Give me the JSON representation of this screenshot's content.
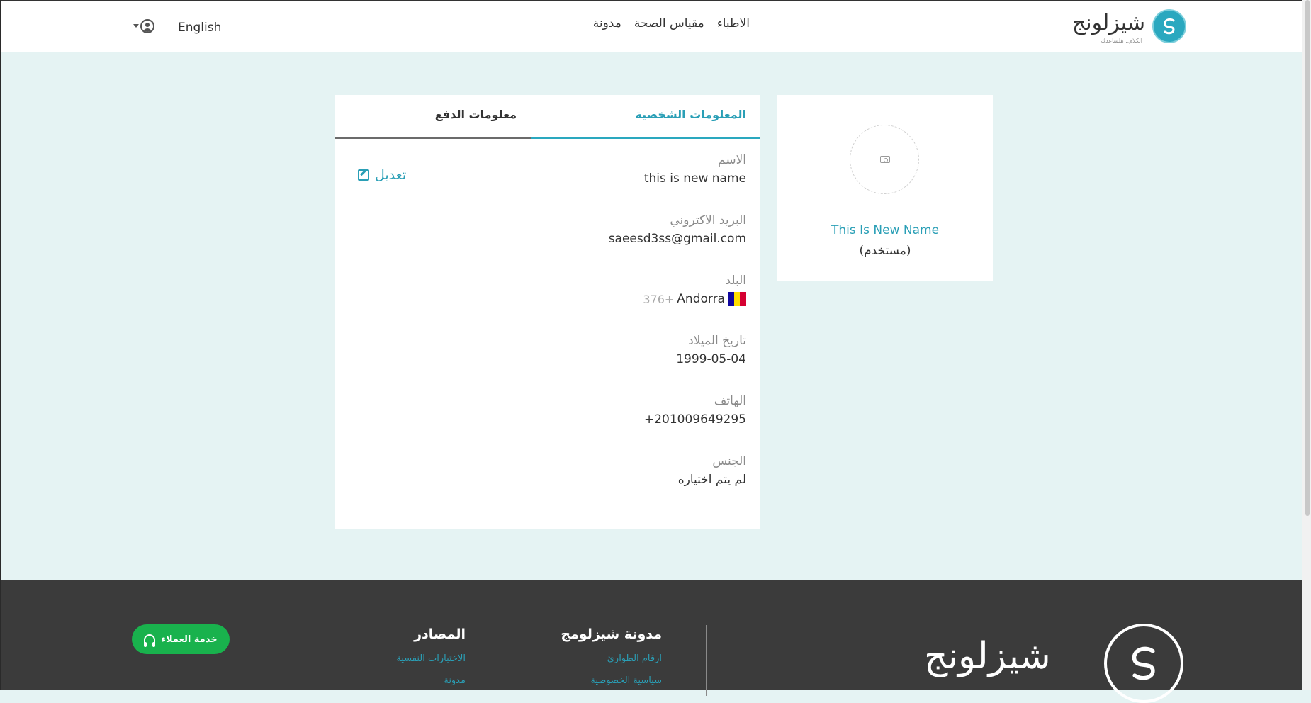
{
  "header": {
    "logo_text": "شيزلونج",
    "logo_sub": "الكلام.. هلساعدك",
    "nav": [
      "الاطباء",
      "مقياس الصحة",
      "مدونة"
    ],
    "language": "English"
  },
  "profile": {
    "name": "This Is New Name",
    "role": "(مستخدم)"
  },
  "tabs": {
    "personal": "المعلومات الشخصية",
    "payment": "معلومات الدفع"
  },
  "fields": {
    "name_label": "الاسم",
    "name_value": "this is new name",
    "email_label": "البريد الاكتروني",
    "email_value": "saeesd3ss@gmail.com",
    "country_label": "البلد",
    "country_code": "376+",
    "country_name": "Andorra",
    "birth_label": "تاريخ الميلاد",
    "birth_value": "1999-05-04",
    "phone_label": "الهاتف",
    "phone_value": "+201009649295",
    "gender_label": "الجنس",
    "gender_value": "لم يتم اختياره"
  },
  "edit_label": "تعديل",
  "footer": {
    "customer_service": "خدمة العملاء",
    "sources_title": "المصادر",
    "sources_links": [
      "الاختبارات النفسية",
      "مدونة"
    ],
    "blog_title": "مدونة شيزلومج",
    "blog_links": [
      "ارقام الطوارئ",
      "سياسية الخصوصية"
    ],
    "logo_text": "شيزلونج"
  },
  "colors": {
    "accent": "#2aa8bf",
    "page_bg": "#e5f3f3",
    "footer_bg": "#3b3b3b",
    "cs_button": "#19b24d"
  }
}
